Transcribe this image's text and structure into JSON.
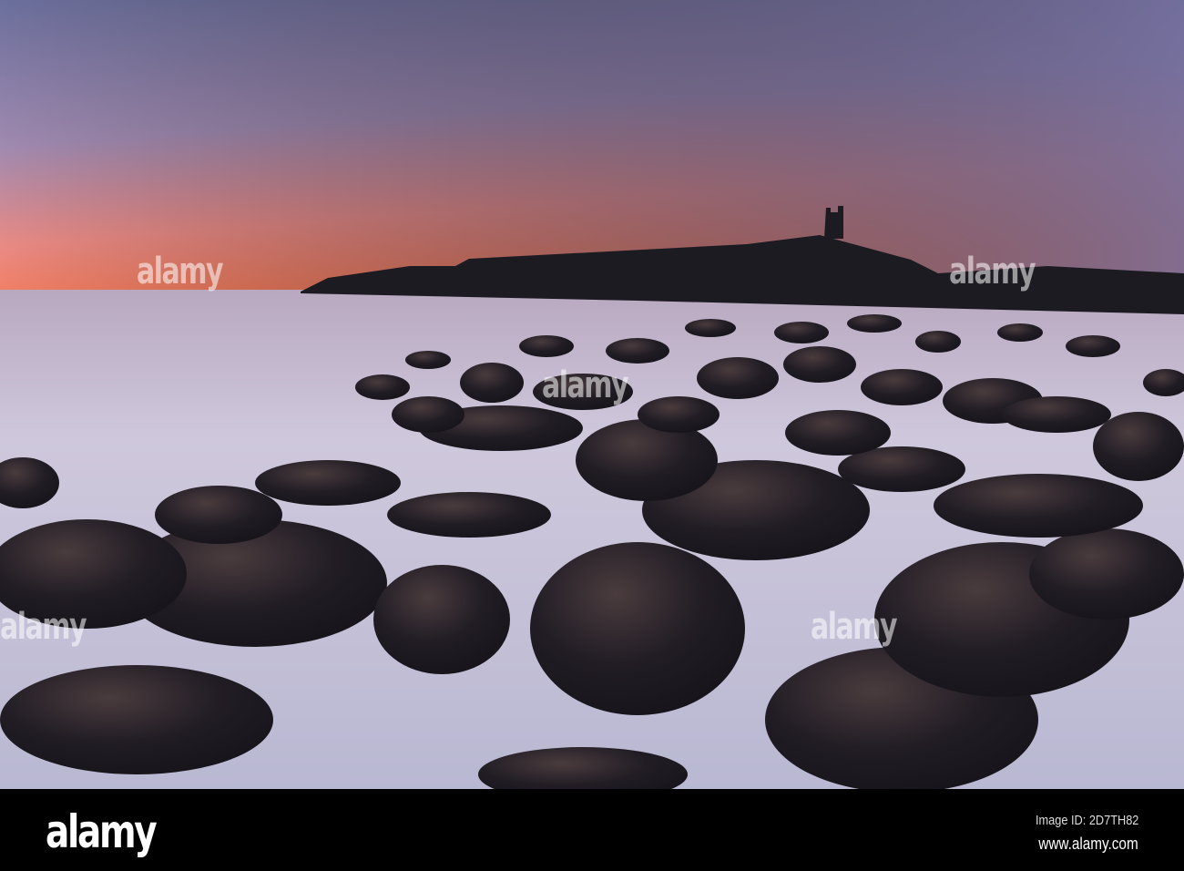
{
  "footer": {
    "logo": "alamy",
    "image_id": "Image ID: 2D7TH82",
    "website": "www.alamy.com"
  },
  "watermark": "alamy",
  "colors": {
    "sky_top": "#6f74a0",
    "sky_horizon": "#f27a5c",
    "mist": "#c9c6da",
    "rock": "#1d1a21"
  }
}
